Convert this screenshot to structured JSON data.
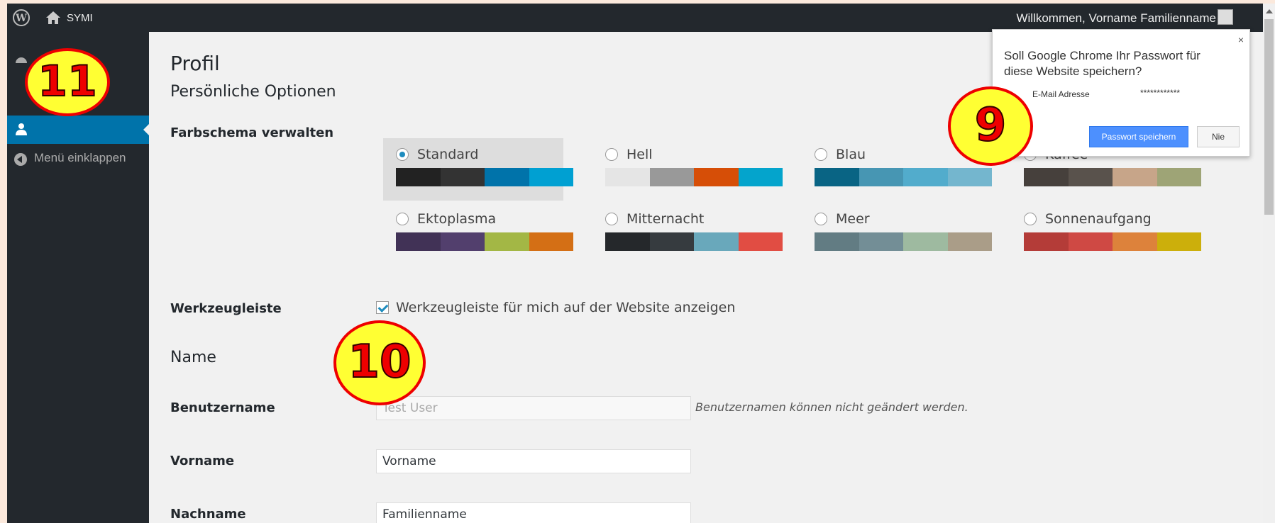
{
  "adminbar": {
    "site_name": "SYMI",
    "welcome": "Willkommen, Vorname Familienname"
  },
  "sidebar": {
    "collapse_label": "Menü einklappen"
  },
  "page": {
    "title": "Profil",
    "personal_options_heading": "Persönliche Optionen",
    "color_scheme_label": "Farbschema verwalten",
    "toolbar_label": "Werkzeugleiste",
    "toolbar_checkbox_label": "Werkzeugleiste für mich auf der Website anzeigen",
    "toolbar_checked": true,
    "name_heading": "Name",
    "username_label": "Benutzername",
    "username_value": "Test User",
    "username_hint": "Benutzernamen können nicht geändert werden.",
    "firstname_label": "Vorname",
    "firstname_value": "Vorname",
    "lastname_label": "Nachname",
    "lastname_value": "Familienname"
  },
  "color_schemes": [
    {
      "name": "Standard",
      "selected": true,
      "colors": [
        "#222222",
        "#333333",
        "#0073aa",
        "#00a0d2"
      ]
    },
    {
      "name": "Hell",
      "selected": false,
      "colors": [
        "#e5e5e5",
        "#999999",
        "#d64e07",
        "#04a4cc"
      ]
    },
    {
      "name": "Blau",
      "selected": false,
      "colors": [
        "#096484",
        "#4796b3",
        "#52accc",
        "#74b6ce"
      ]
    },
    {
      "name": "Kaffee",
      "selected": false,
      "colors": [
        "#46403c",
        "#59524c",
        "#c7a589",
        "#9ea476"
      ]
    },
    {
      "name": "Ektoplasma",
      "selected": false,
      "colors": [
        "#413256",
        "#523f6d",
        "#a3b745",
        "#d46f15"
      ]
    },
    {
      "name": "Mitternacht",
      "selected": false,
      "colors": [
        "#25282b",
        "#363b3f",
        "#69a8bb",
        "#e14d43"
      ]
    },
    {
      "name": "Meer",
      "selected": false,
      "colors": [
        "#627c83",
        "#738e96",
        "#9ebaa0",
        "#aa9d88"
      ]
    },
    {
      "name": "Sonnenaufgang",
      "selected": false,
      "colors": [
        "#b43c38",
        "#cf4944",
        "#dd823b",
        "#ccaf0b"
      ]
    }
  ],
  "password_popup": {
    "close": "×",
    "message": "Soll Google Chrome Ihr Passwort für diese Website speichern?",
    "field_label": "E-Mail Adresse",
    "field_value": "************",
    "save_button": "Passwort speichern",
    "never_button": "Nie"
  },
  "badges": [
    "11",
    "9",
    "10"
  ],
  "colors": {
    "adminbar": "#23282d",
    "accent": "#0073aa",
    "badge_fill": "#ffff33",
    "badge_border": "#ee0000"
  }
}
